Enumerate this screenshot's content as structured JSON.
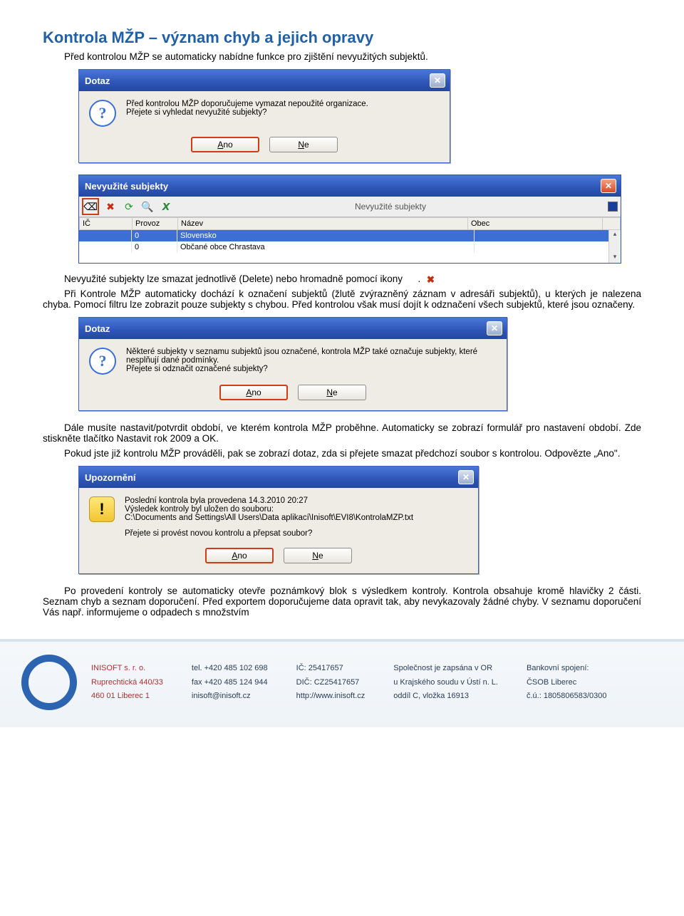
{
  "heading": "Kontrola MŽP – význam chyb a jejich opravy",
  "p_intro": "Před kontrolou MŽP se automaticky nabídne funkce pro zjištění nevyužitých subjektů.",
  "dlg1": {
    "title": "Dotaz",
    "line1": "Před kontrolou MŽP doporučujeme vymazat nepoužité organizace.",
    "line2": "Přejete si vyhledat nevyužité subjekty?",
    "btn_yes": "Ano",
    "btn_no": "Ne"
  },
  "subjects_win": {
    "title": "Nevyužité subjekty",
    "toolbar_title": "Nevyužité subjekty",
    "columns": {
      "ic": "IČ",
      "provoz": "Provoz",
      "nazev": "Název",
      "obec": "Obec"
    },
    "rows": [
      {
        "ic": "",
        "provoz": "0",
        "nazev": "Slovensko",
        "obec": ""
      },
      {
        "ic": "",
        "provoz": "0",
        "nazev": "Občané obce Chrastava",
        "obec": ""
      }
    ]
  },
  "p_delete": "Nevyužité subjekty lze smazat jednotlivě (Delete) nebo hromadně pomocí ikony ",
  "p_delete_tail": ".",
  "p_control": "Při Kontrole MŽP automaticky dochází k označení subjektů (žlutě zvýrazněný záznam v adresáři subjektů), u kterých je nalezena chyba. Pomocí filtru lze zobrazit pouze subjekty s chybou. Před kontrolou však musí dojít k odznačení všech subjektů, které jsou označeny.",
  "dlg2": {
    "title": "Dotaz",
    "line1": "Některé subjekty v seznamu subjektů jsou označené, kontrola MŽP také označuje subjekty, které nesplňují dané podmínky.",
    "line2": "Přejete si odznačit označené subjekty?",
    "btn_yes": "Ano",
    "btn_no": "Ne"
  },
  "p_period": "Dále musíte nastavit/potvrdit období, ve kterém kontrola MŽP proběhne. Automaticky se zobrazí formulář pro nastavení období. Zde stiskněte tlačítko Nastavit rok 2009 a OK.",
  "p_already": "Pokud jste již kontrolu MŽP prováděli, pak se zobrazí dotaz, zda si přejete smazat předchozí soubor s kontrolou. Odpovězte „Ano\".",
  "dlg3": {
    "title": "Upozornění",
    "line1": "Poslední kontrola byla provedena 14.3.2010   20:27",
    "line2": "Výsledek kontroly byl uložen do souboru:",
    "line3": "C:\\Documents and Settings\\All Users\\Data aplikací\\Inisoft\\EVI8\\KontrolaMZP.txt",
    "line4": "Přejete si provést novou kontrolu a přepsat soubor?",
    "btn_yes": "Ano",
    "btn_no": "Ne"
  },
  "p_after": "Po provedení kontroly se automaticky otevře poznámkový blok s výsledkem kontroly. Kontrola obsahuje kromě hlavičky 2 části. Seznam chyb a seznam doporučení. Před exportem doporučujeme data opravit tak, aby nevykazovaly žádné chyby. V seznamu doporučení Vás např. informujeme o odpadech s množstvím",
  "footer": {
    "c1": {
      "a": "INISOFT s. r. o.",
      "b": "Ruprechtická 440/33",
      "c": "460 01 Liberec 1"
    },
    "c2": {
      "a": "tel. +420 485 102 698",
      "b": "fax +420 485 124 944",
      "c": "inisoft@inisoft.cz"
    },
    "c3": {
      "a": "IČ: 25417657",
      "b": "DIČ: CZ25417657",
      "c": "http://www.inisoft.cz"
    },
    "c4": {
      "a": "Společnost je zapsána v OR",
      "b": "u Krajského soudu v Ústí n. L.",
      "c": "oddíl C, vložka 16913"
    },
    "c5": {
      "a": "Bankovní spojení:",
      "b": "ČSOB Liberec",
      "c": "č.ú.: 1805806583/0300"
    }
  }
}
